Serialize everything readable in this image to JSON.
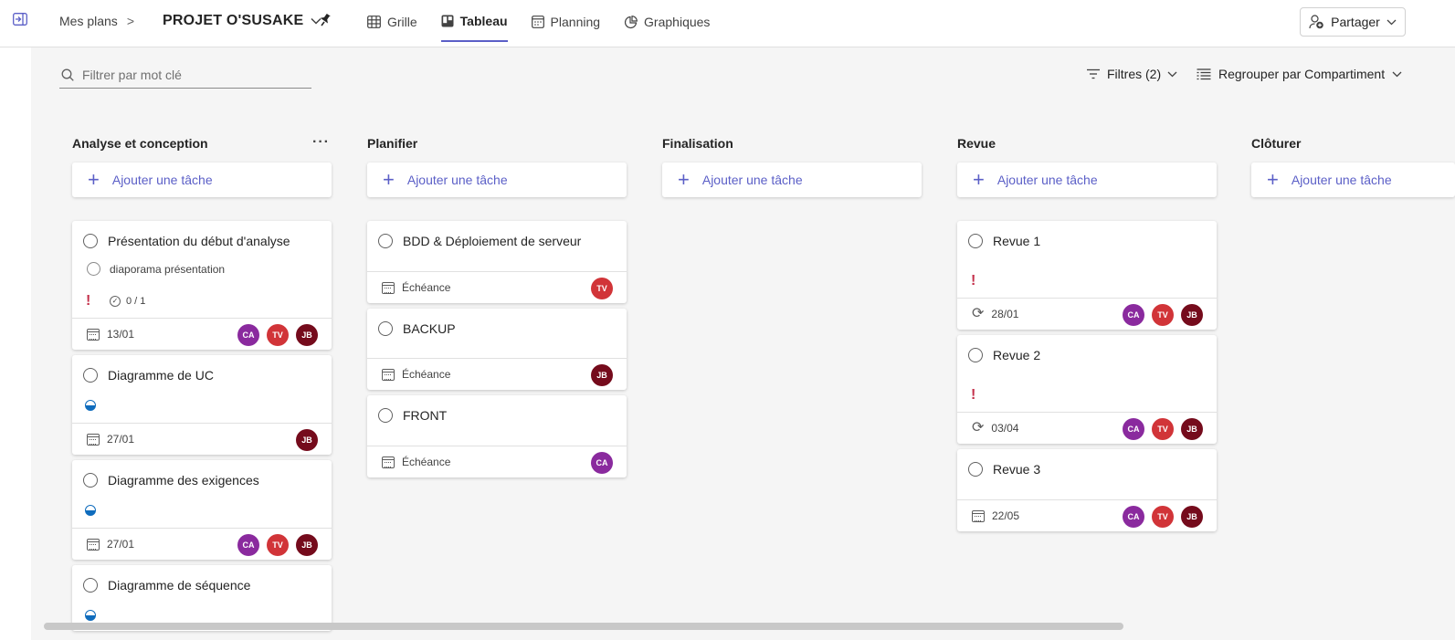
{
  "header": {
    "breadcrumb_root": "Mes plans",
    "breadcrumb_sep": ">",
    "plan_title": "PROJET O'SUSAKE",
    "tabs": [
      {
        "label": "Grille",
        "icon": "grid-icon"
      },
      {
        "label": "Tableau",
        "icon": "board-icon",
        "active": true
      },
      {
        "label": "Planning",
        "icon": "calendar-icon"
      },
      {
        "label": "Graphiques",
        "icon": "chart-icon"
      }
    ],
    "share_label": "Partager"
  },
  "toolbar": {
    "search_placeholder": "Filtrer par mot clé",
    "filters_label": "Filtres (2)",
    "group_by_label": "Regrouper par Compartiment"
  },
  "colors": {
    "accent": "#5b5fc7",
    "urgent": "#c4314b",
    "avatar_CA": "#8a2a9e",
    "avatar_TV": "#d13438",
    "avatar_JB": "#750b1c"
  },
  "board": {
    "add_task_label": "Ajouter une tâche",
    "more_label": "···",
    "columns": [
      {
        "title": "Analyse et conception",
        "cards": [
          {
            "title": "Présentation du début d'analyse",
            "subtask": "diaporama présentation",
            "urgent": "!",
            "checklist": "0 / 1",
            "date": "13/01",
            "assignees": [
              "CA",
              "TV",
              "JB"
            ]
          },
          {
            "title": "Diagramme de UC",
            "progress": 0.5,
            "date": "27/01",
            "assignees": [
              "JB"
            ]
          },
          {
            "title": "Diagramme des exigences",
            "progress": 0.5,
            "date": "27/01",
            "assignees": [
              "CA",
              "TV",
              "JB"
            ]
          },
          {
            "title": "Diagramme de séquence",
            "progress": 0.5
          }
        ]
      },
      {
        "title": "Planifier",
        "cards": [
          {
            "title": "BDD & Déploiement de serveur",
            "date": "Échéance",
            "assignees": [
              "TV"
            ]
          },
          {
            "title": "BACKUP",
            "date": "Échéance",
            "assignees": [
              "JB"
            ]
          },
          {
            "title": "FRONT",
            "date": "Échéance",
            "assignees": [
              "CA"
            ]
          }
        ]
      },
      {
        "title": "Finalisation",
        "cards": []
      },
      {
        "title": "Revue",
        "cards": [
          {
            "title": "Revue 1",
            "urgent": "!",
            "date": "28/01",
            "recurring": true,
            "assignees": [
              "CA",
              "TV",
              "JB"
            ]
          },
          {
            "title": "Revue 2",
            "urgent": "!",
            "date": "03/04",
            "recurring": true,
            "assignees": [
              "CA",
              "TV",
              "JB"
            ]
          },
          {
            "title": "Revue 3",
            "date": "22/05",
            "assignees": [
              "CA",
              "TV",
              "JB"
            ]
          }
        ]
      },
      {
        "title": "Clôturer",
        "cards": []
      }
    ]
  }
}
